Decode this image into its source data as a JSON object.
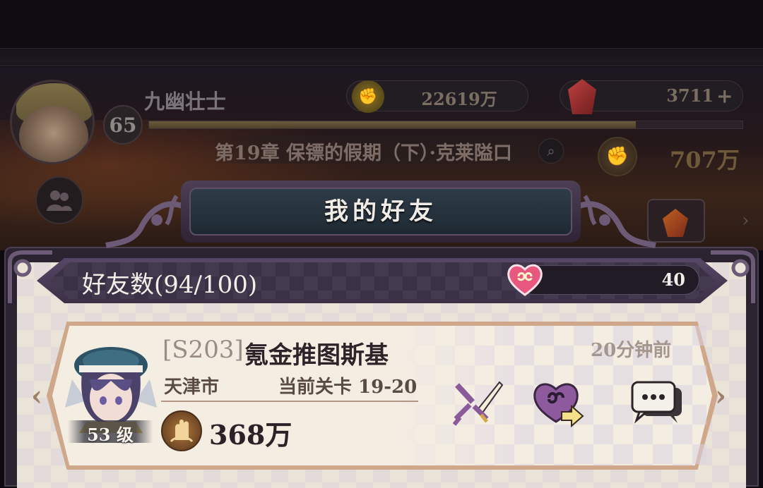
{
  "hud": {
    "player_name": "九幽壮士",
    "player_level": "65",
    "gold": "22619万",
    "gems": "3711",
    "gems_add": "+",
    "exp_progress": 0.82,
    "chapter": "第19章 保镖的假期（下）·克莱隘口",
    "power": "707万"
  },
  "panel": {
    "title": "我的好友",
    "friend_count": "好友数(94/100)",
    "hearts": "40"
  },
  "friend": {
    "server": "[S203]",
    "name": "氪金推图斯基",
    "last_online": "20分钟前",
    "city": "天津市",
    "stage": "当前关卡 19-20",
    "level": "53 级",
    "power": "368万"
  },
  "icons": {
    "battle": "crossed-swords-icon",
    "gift": "heart-send-icon",
    "chat": "chat-bubbles-icon",
    "gold": "gold-coin-icon",
    "gem": "red-gem-icon",
    "power": "fist-power-icon",
    "friends": "friends-icon",
    "search": "search-icon",
    "hearts": "friendship-heart-icon"
  },
  "colors": {
    "panel_frame": "#2b2330",
    "card_border": "#cfa78b",
    "card_bg": "#f3ede2",
    "heart_pink": "#e8577e"
  }
}
